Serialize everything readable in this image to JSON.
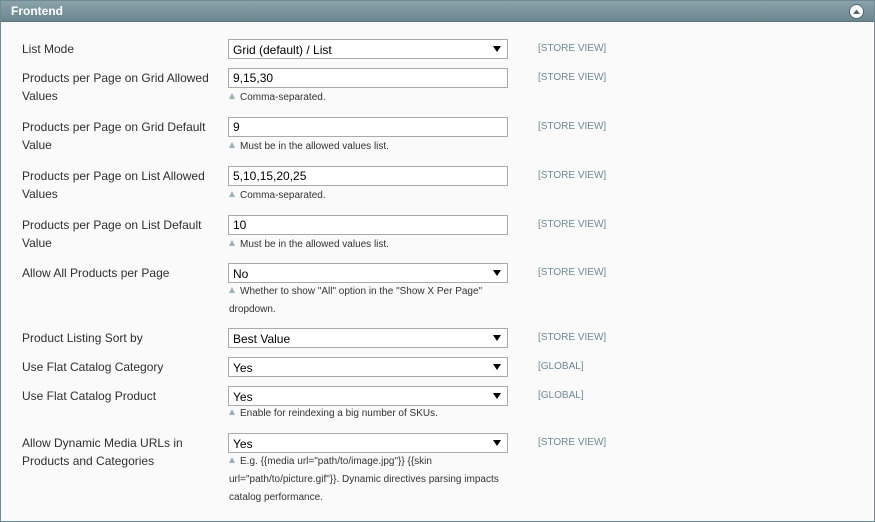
{
  "section": {
    "title": "Frontend"
  },
  "rows": [
    {
      "label": "List Mode",
      "type": "select",
      "value": "Grid (default) / List",
      "scope": "[STORE VIEW]",
      "note": ""
    },
    {
      "label": "Products per Page on Grid Allowed Values",
      "type": "text",
      "value": "9,15,30",
      "scope": "[STORE VIEW]",
      "note": "Comma-separated."
    },
    {
      "label": "Products per Page on Grid Default Value",
      "type": "text",
      "value": "9",
      "scope": "[STORE VIEW]",
      "note": "Must be in the allowed values list."
    },
    {
      "label": "Products per Page on List Allowed Values",
      "type": "text",
      "value": "5,10,15,20,25",
      "scope": "[STORE VIEW]",
      "note": "Comma-separated."
    },
    {
      "label": "Products per Page on List Default Value",
      "type": "text",
      "value": "10",
      "scope": "[STORE VIEW]",
      "note": "Must be in the allowed values list."
    },
    {
      "label": "Allow All Products per Page",
      "type": "select",
      "value": "No",
      "scope": "[STORE VIEW]",
      "note": "Whether to show \"All\" option in the \"Show X Per Page\" dropdown."
    },
    {
      "label": "Product Listing Sort by",
      "type": "select",
      "value": "Best Value",
      "scope": "[STORE VIEW]",
      "note": ""
    },
    {
      "label": "Use Flat Catalog Category",
      "type": "select",
      "value": "Yes",
      "scope": "[GLOBAL]",
      "note": ""
    },
    {
      "label": "Use Flat Catalog Product",
      "type": "select",
      "value": "Yes",
      "scope": "[GLOBAL]",
      "note": "Enable for reindexing a big number of SKUs."
    },
    {
      "label": "Allow Dynamic Media URLs in Products and Categories",
      "type": "select",
      "value": "Yes",
      "scope": "[STORE VIEW]",
      "note": "E.g. {{media url=\"path/to/image.jpg\"}} {{skin url=\"path/to/picture.gif\"}}. Dynamic directives parsing impacts catalog performance."
    }
  ]
}
